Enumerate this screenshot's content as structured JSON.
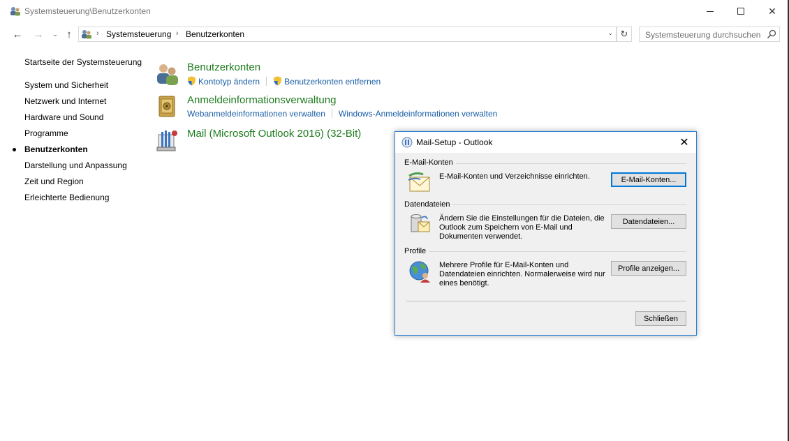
{
  "window": {
    "title": "Systemsteuerung\\Benutzerkonten",
    "minimize_label": "",
    "maximize_label": "",
    "close_glyph": "✕"
  },
  "address_bar": {
    "back_glyph": "←",
    "forward_glyph": "→",
    "recent_glyph": "⌄",
    "up_glyph": "↑",
    "breadcrumbs": [
      "Systemsteuerung",
      "Benutzerkonten"
    ],
    "separator": "›",
    "dropdown_glyph": "⌄",
    "refresh_glyph": "↻",
    "search_placeholder": "Systemsteuerung durchsuchen"
  },
  "sidebar": {
    "home": "Startseite der Systemsteuerung",
    "items": [
      {
        "label": "System und Sicherheit",
        "active": false
      },
      {
        "label": "Netzwerk und Internet",
        "active": false
      },
      {
        "label": "Hardware und Sound",
        "active": false
      },
      {
        "label": "Programme",
        "active": false
      },
      {
        "label": "Benutzerkonten",
        "active": true
      },
      {
        "label": "Darstellung und Anpassung",
        "active": false
      },
      {
        "label": "Zeit und Region",
        "active": false
      },
      {
        "label": "Erleichterte Bedienung",
        "active": false
      }
    ]
  },
  "main": {
    "categories": [
      {
        "title": "Benutzerkonten",
        "icon": "users-icon",
        "links": [
          {
            "label": "Kontotyp ändern",
            "shield": true
          },
          {
            "label": "Benutzerkonten entfernen",
            "shield": true
          }
        ]
      },
      {
        "title": "Anmeldeinformationsverwaltung",
        "icon": "credential-vault-icon",
        "links": [
          {
            "label": "Webanmeldeinformationen verwalten",
            "shield": false
          },
          {
            "label": "Windows-Anmeldeinformationen verwalten",
            "shield": false
          }
        ]
      },
      {
        "title": "Mail (Microsoft Outlook 2016) (32-Bit)",
        "icon": "mail-icon",
        "links": []
      }
    ]
  },
  "dialog": {
    "title": "Mail-Setup - Outlook",
    "close_glyph": "✕",
    "sections": [
      {
        "label": "E-Mail-Konten",
        "text": "E-Mail-Konten und Verzeichnisse einrichten.",
        "button": "E-Mail-Konten...",
        "icon": "email-accounts-icon"
      },
      {
        "label": "Datendateien",
        "text": "Ändern Sie die Einstellungen für die Dateien, die Outlook zum Speichern von E-Mail und Dokumenten verwendet.",
        "button": "Datendateien...",
        "icon": "data-files-icon"
      },
      {
        "label": "Profile",
        "text": "Mehrere Profile für E-Mail-Konten und Datendateien einrichten. Normalerweise wird nur eines benötigt.",
        "button": "Profile anzeigen...",
        "icon": "profiles-icon"
      }
    ],
    "close_button": "Schließen"
  },
  "colors": {
    "category_title": "#1e7b1e",
    "link": "#1a5ea5",
    "dialog_border": "#2b7fd3",
    "default_button_border": "#0078d7"
  }
}
